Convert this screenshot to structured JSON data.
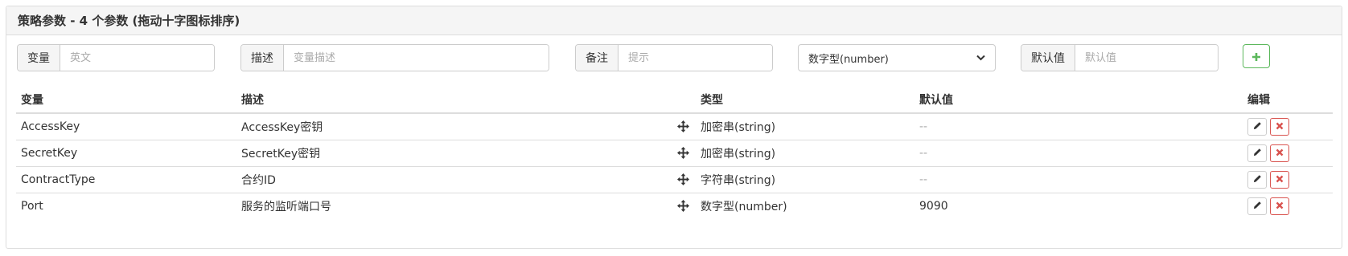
{
  "panel": {
    "title": "策略参数 - 4 个参数 (拖动十字图标排序)"
  },
  "form": {
    "variable_label": "变量",
    "variable_placeholder": "英文",
    "desc_label": "描述",
    "desc_placeholder": "变量描述",
    "note_label": "备注",
    "note_placeholder": "提示",
    "type_selected": "数字型(number)",
    "default_label": "默认值",
    "default_placeholder": "默认值",
    "add_icon": "plus-icon"
  },
  "table": {
    "headers": {
      "variable": "变量",
      "desc": "描述",
      "type": "类型",
      "default": "默认值",
      "edit": "编辑"
    },
    "rows": [
      {
        "variable": "AccessKey",
        "desc": "AccessKey密钥",
        "type": "加密串(string)",
        "default": "--"
      },
      {
        "variable": "SecretKey",
        "desc": "SecretKey密钥",
        "type": "加密串(string)",
        "default": "--"
      },
      {
        "variable": "ContractType",
        "desc": "合约ID",
        "type": "字符串(string)",
        "default": "--"
      },
      {
        "variable": "Port",
        "desc": "服务的监听端口号",
        "type": "数字型(number)",
        "default": "9090"
      }
    ]
  },
  "colors": {
    "accent_green": "#5cb85c",
    "danger_red": "#d9534f",
    "border": "#dddddd"
  }
}
